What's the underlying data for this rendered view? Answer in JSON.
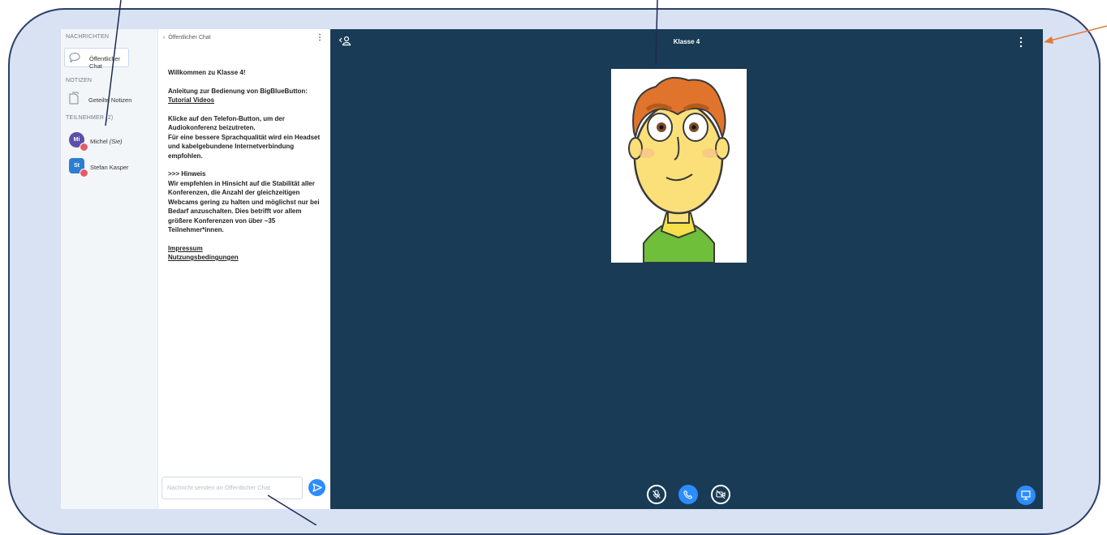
{
  "sidebar": {
    "messages_title": "NACHRICHTEN",
    "public_chat_label": "Öffentlicher Chat",
    "notes_title": "NOTIZEN",
    "shared_notes_label": "Geteilte Notizen",
    "participants_title": "TEILNEHMER (2)",
    "users": [
      {
        "initials": "Mi",
        "name": "Michel",
        "suffix": "(Sie)",
        "color": "#5b4fa8"
      },
      {
        "initials": "St",
        "name": "Stefan Kasper",
        "color": "#2d7dd2"
      }
    ]
  },
  "chat": {
    "header": "Öffentlicher Chat",
    "welcome": "Willkommen zu Klasse 4!",
    "guide_text": "Anleitung zur Bedienung von BigBlueButton:",
    "guide_link": "Tutorial Videos",
    "audio_line1": "Klicke auf den Telefon-Button, um der Audiokonferenz beizutreten.",
    "audio_line2": "Für eine bessere Sprachqualität wird ein Headset und kabelgebundene Internetverbindung empfohlen.",
    "hint_title": ">>> Hinweis",
    "hint_text": "Wir empfehlen in Hinsicht auf die Stabilität aller Konferenzen, die Anzahl der gleichzeitigen Webcams gering zu halten und möglichst nur bei Bedarf anzuschalten. Dies betrifft vor allem größere Konferenzen von über ~35 Teilnehmer*innen.",
    "impressum": "Impressum",
    "terms": "Nutzungsbedingungen",
    "input_placeholder": "Nachricht senden an Öffentlicher Chat"
  },
  "main": {
    "title": "Klasse 4"
  },
  "colors": {
    "accent": "#2d8cff",
    "main_bg": "#193b55",
    "frame_bg": "#d8e2f3",
    "annotation_arrow": "#e07a35"
  }
}
